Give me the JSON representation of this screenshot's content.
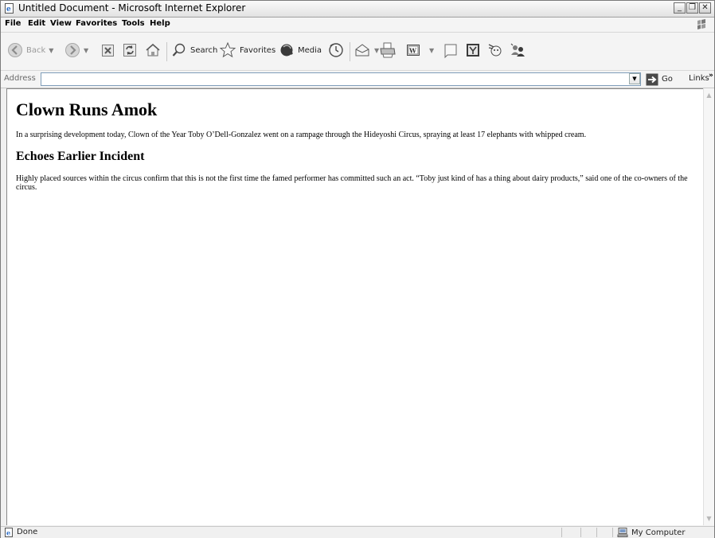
{
  "window": {
    "title": "Untitled Document - Microsoft Internet Explorer",
    "buttons": {
      "minimize": "_",
      "restore": "❐",
      "close": "✕"
    }
  },
  "menubar": {
    "items": [
      "File",
      "Edit",
      "View",
      "Favorites",
      "Tools",
      "Help"
    ]
  },
  "toolbar": {
    "back_label": "Back",
    "search_label": "Search",
    "favorites_label": "Favorites",
    "media_label": "Media"
  },
  "addressbar": {
    "label": "Address",
    "value": "",
    "go_label": "Go",
    "links_label": "Links",
    "links_more": "»"
  },
  "document": {
    "heading1": "Clown Runs Amok",
    "paragraph1": "In a surprising development today, Clown of the Year Toby O’Dell-Gonzalez went on a rampage through the Hideyoshi Circus, spraying at least 17 elephants with whipped cream.",
    "heading2": "Echoes Earlier Incident",
    "paragraph2": "Highly placed sources within the circus confirm that this is not the first time the famed performer has committed such an act. “Toby just kind of has a thing about dairy products,” said one of the co-owners of the circus."
  },
  "statusbar": {
    "status": "Done",
    "zone": "My Computer"
  },
  "colors": {
    "ie_blue": "#2a6dc8",
    "go_green": "#3a9a2a",
    "address_border": "#7f9db9"
  },
  "icons": {
    "app": "ie-page-icon",
    "back": "back-arrow-icon",
    "forward": "forward-arrow-icon",
    "stop": "stop-icon",
    "refresh": "refresh-icon",
    "home": "home-icon",
    "search": "search-icon",
    "favorites": "favorites-star-icon",
    "media": "media-icon",
    "history": "history-icon",
    "mail": "mail-icon",
    "print": "print-icon",
    "edit": "edit-word-icon",
    "discuss": "discuss-icon",
    "research": "research-icon",
    "messenger": "messenger-icon",
    "go": "go-arrow-icon",
    "zone": "my-computer-icon"
  }
}
